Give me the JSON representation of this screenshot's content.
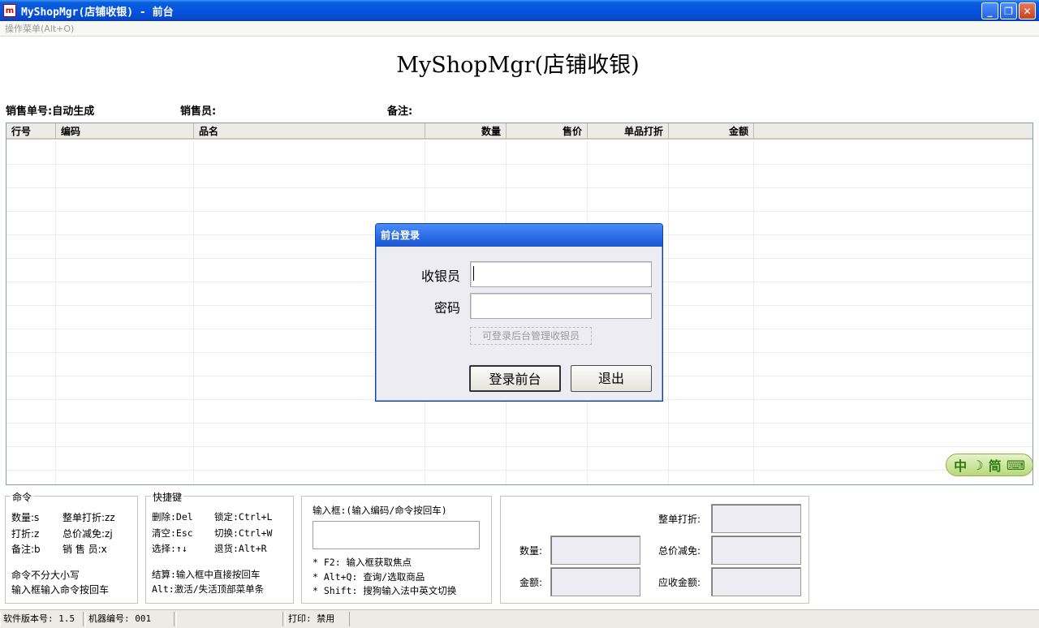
{
  "window": {
    "app_icon_letter": "m",
    "title": "MyShopMgr(店铺收银) - 前台",
    "minimize": "_",
    "restore": "❐",
    "close": "✕"
  },
  "menu": {
    "label": "操作菜单(Alt+O)"
  },
  "main_title": "MyShopMgr(店铺收银)",
  "info": {
    "order_no": "销售单号:自动生成",
    "salesperson": "销售员:",
    "remark": "备注:"
  },
  "grid": {
    "columns": [
      "行号",
      "编码",
      "品名",
      "数量",
      "售价",
      "单品打折",
      "金额"
    ]
  },
  "login_dialog": {
    "title": "前台登录",
    "cashier_label": "收银员",
    "cashier_value": "",
    "password_label": "密码",
    "password_value": "",
    "hint": "可登录后台管理收银员",
    "login_button": "登录前台",
    "exit_button": "退出"
  },
  "ime": {
    "chinese": "中",
    "simplified": "简"
  },
  "commands_panel": {
    "legend": "命令",
    "lines": [
      "数量:s",
      "整单打折:zz",
      "打折:z",
      "总价减免:zj",
      "备注:b",
      "销 售 员:x",
      "命令不分大小写",
      "输入框输入命令按回车"
    ]
  },
  "shortcuts_panel": {
    "legend": "快捷键",
    "lines": [
      "删除:Del",
      "锁定:Ctrl+L",
      "清空:Esc",
      "切换:Ctrl+W",
      "选择:↑↓",
      "退货:Alt+R",
      "结算:输入框中直接按回车",
      "Alt:激活/失活顶部菜单条"
    ]
  },
  "input_panel": {
    "label": "输入框:(输入编码/命令按回车)",
    "value": "",
    "tips": [
      "* F2: 输入框获取焦点",
      "* Alt+Q: 查询/选取商品",
      "* Shift: 搜狗输入法中英文切换"
    ]
  },
  "summary_panel": {
    "quantity_label": "数量:",
    "amount_label": "金额:",
    "whole_discount_label": "整单打折:",
    "total_reduction_label": "总价减免:",
    "receivable_label": "应收金额:",
    "quantity": "",
    "amount": "",
    "whole_discount": "",
    "total_reduction": "",
    "receivable": ""
  },
  "status": {
    "version": "软件版本号: 1.5",
    "machine": "机器编号: 001",
    "blank": "",
    "print": "打印: 禁用"
  }
}
